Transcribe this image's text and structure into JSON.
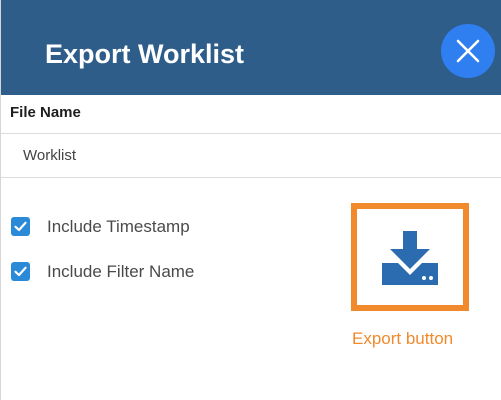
{
  "header": {
    "title": "Export Worklist",
    "close_icon": "close-icon",
    "background_color": "#2f5d8a",
    "close_button_color": "#2f7ff0"
  },
  "file_name": {
    "label": "File Name",
    "value": "Worklist"
  },
  "options": [
    {
      "label": "Include Timestamp",
      "checked": true
    },
    {
      "label": "Include Filter Name",
      "checked": true
    }
  ],
  "export": {
    "icon": "download-icon",
    "caption": "Export button",
    "highlight_color": "#f08a2c",
    "icon_color": "#2b6cb0"
  }
}
